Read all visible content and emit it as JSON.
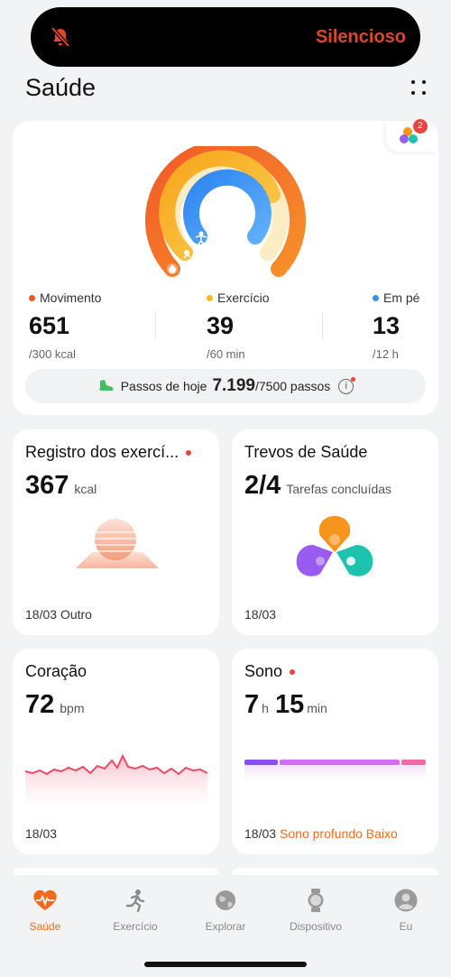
{
  "status_island": {
    "text": "Silencioso",
    "icon": "bell-off-icon",
    "color": "#e2452f"
  },
  "header": {
    "title": "Saúde",
    "menu_icon": "grid-dots-icon"
  },
  "activity": {
    "clover_badge_count": "2",
    "stats": [
      {
        "label": "Movimento",
        "value": "651",
        "target": "/300 kcal",
        "color": "#f0552b",
        "progress": 1.0
      },
      {
        "label": "Exercício",
        "value": "39",
        "target": "/60 min",
        "color": "#f9b82b",
        "progress": 0.65
      },
      {
        "label": "Em pé",
        "value": "13",
        "target": "/12 h",
        "color": "#3b8ff0",
        "progress": 1.0
      }
    ],
    "steps": {
      "prefix": "Passos de hoje",
      "value": "7.199",
      "suffix": "/7500 passos",
      "info": "i"
    }
  },
  "tiles": {
    "exercise_log": {
      "title": "Registro dos exercí...",
      "value": "367",
      "unit": "kcal",
      "date": "18/03",
      "type": "Outro"
    },
    "health_clovers": {
      "title": "Trevos de Saúde",
      "value": "2/4",
      "unit": "Tarefas concluídas",
      "date": "18/03"
    },
    "heart": {
      "title": "Coração",
      "value": "72",
      "unit": "bpm",
      "date": "18/03"
    },
    "sleep": {
      "title": "Sono",
      "hours": "7",
      "hours_unit": "h",
      "minutes": "15",
      "minutes_unit": "min",
      "date": "18/03",
      "note": "Sono profundo Baixo"
    }
  },
  "tabbar": {
    "items": [
      {
        "label": "Saúde",
        "icon": "heart-pulse-icon",
        "active": true
      },
      {
        "label": "Exercício",
        "icon": "running-icon",
        "active": false
      },
      {
        "label": "Explorar",
        "icon": "globe-icon",
        "active": false
      },
      {
        "label": "Dispositivo",
        "icon": "watch-icon",
        "active": false
      },
      {
        "label": "Eu",
        "icon": "user-icon",
        "active": false
      }
    ]
  }
}
